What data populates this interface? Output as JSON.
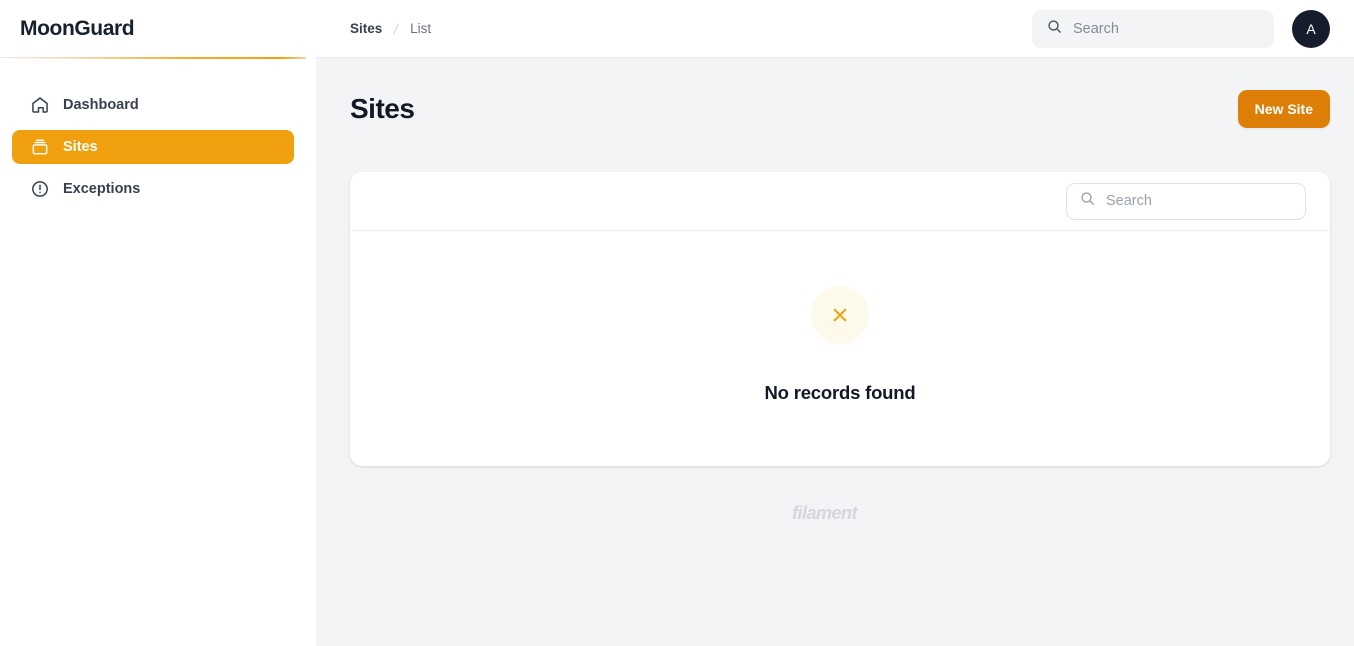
{
  "sidebar": {
    "brand": "MoonGuard",
    "items": [
      {
        "label": "Dashboard",
        "icon": "home-icon",
        "active": false
      },
      {
        "label": "Sites",
        "icon": "archive-box-icon",
        "active": true
      },
      {
        "label": "Exceptions",
        "icon": "exclamation-circle-icon",
        "active": false
      }
    ]
  },
  "topbar": {
    "breadcrumb": {
      "root": "Sites",
      "separator": "/",
      "current": "List"
    },
    "search": {
      "placeholder": "Search",
      "value": "",
      "icon": "search-icon"
    },
    "avatar": {
      "initial": "A",
      "name": "avatar"
    }
  },
  "page": {
    "title": "Sites",
    "new_button": "New Site"
  },
  "table": {
    "search": {
      "placeholder": "Search",
      "value": "",
      "icon": "search-icon"
    },
    "empty_state": {
      "icon": "x-mark-icon",
      "heading": "No records found"
    }
  },
  "footer": {
    "brandmark": "filament"
  },
  "colors": {
    "accent": "#f0a00f",
    "button": "#dd7f07",
    "empty_icon": "#f0a00f",
    "empty_icon_bg": "#fefaeb",
    "avatar_bg": "#151c2c",
    "page_bg": "#f3f4f6",
    "brandmark": "#d3d6dd"
  }
}
